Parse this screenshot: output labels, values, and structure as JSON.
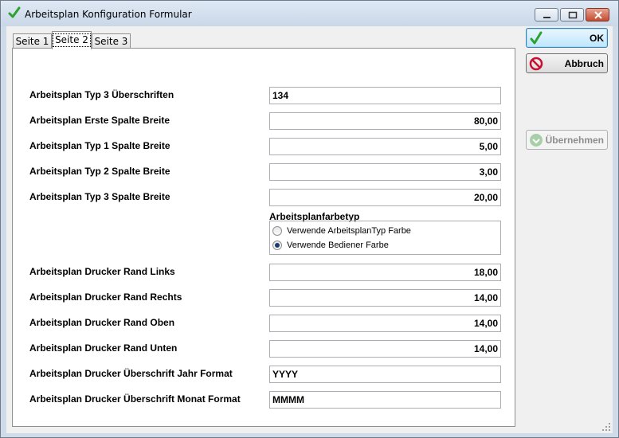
{
  "window": {
    "title": "Arbeitsplan Konfiguration Formular",
    "icon": "green-checkmark-icon"
  },
  "tabs": [
    {
      "label": "Seite 1",
      "active": false
    },
    {
      "label": "Seite 2",
      "active": true
    },
    {
      "label": "Seite 3",
      "active": false
    }
  ],
  "fields": [
    {
      "label": "Arbeitsplan Typ 3 Überschriften",
      "value": "134"
    },
    {
      "label": "Arbeitsplan Erste Spalte Breite",
      "value": "80,00"
    },
    {
      "label": "Arbeitsplan Typ 1 Spalte Breite",
      "value": "5,00"
    },
    {
      "label": "Arbeitsplan Typ 2 Spalte Breite",
      "value": "3,00"
    },
    {
      "label": "Arbeitsplan Typ 3 Spalte Breite",
      "value": "20,00"
    }
  ],
  "color_group": {
    "title": "Arbeitsplanfarbetyp",
    "options": [
      {
        "label": "Verwende ArbeitsplanTyp Farbe",
        "selected": false
      },
      {
        "label": "Verwende Bediener Farbe",
        "selected": true
      }
    ]
  },
  "fields2": [
    {
      "label": "Arbeitsplan Drucker Rand Links",
      "value": "18,00"
    },
    {
      "label": "Arbeitsplan Drucker Rand Rechts",
      "value": "14,00"
    },
    {
      "label": "Arbeitsplan Drucker Rand Oben",
      "value": "14,00"
    },
    {
      "label": "Arbeitsplan Drucker Rand Unten",
      "value": "14,00"
    },
    {
      "label": "Arbeitsplan Drucker Überschrift Jahr Format",
      "value": "YYYY"
    },
    {
      "label": "Arbeitsplan Drucker Überschrift Monat Format",
      "value": "MMMM"
    }
  ],
  "buttons": {
    "ok": "OK",
    "cancel": "Abbruch",
    "apply": "Übernehmen"
  },
  "colors": {
    "accent": "#3c7fb1",
    "ok_icon": "#2ea22e",
    "cancel_icon": "#c8102e"
  }
}
